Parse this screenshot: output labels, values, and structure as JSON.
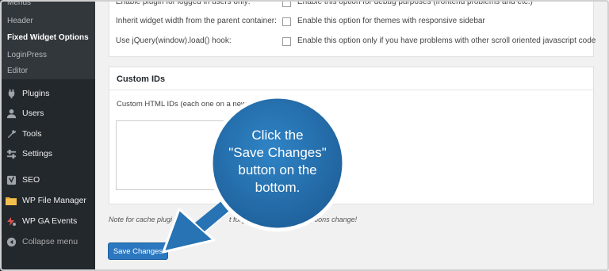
{
  "sidebar": {
    "submenu": {
      "items": [
        {
          "label": "Menus"
        },
        {
          "label": "Header"
        },
        {
          "label": "Fixed Widget Options"
        },
        {
          "label": "LoginPress"
        },
        {
          "label": "Editor"
        }
      ]
    },
    "menu": [
      {
        "label": "Plugins",
        "icon": "plug-icon"
      },
      {
        "label": "Users",
        "icon": "user-icon"
      },
      {
        "label": "Tools",
        "icon": "wrench-icon"
      },
      {
        "label": "Settings",
        "icon": "settings-icon"
      },
      {
        "label": "SEO",
        "icon": "yoast-icon"
      },
      {
        "label": "WP File Manager",
        "icon": "folder-icon"
      },
      {
        "label": "WP GA Events",
        "icon": "ga-events-icon"
      }
    ],
    "collapse_label": "Collapse menu",
    "colors": {
      "bg": "#23282d",
      "submenu_bg": "#32373c"
    }
  },
  "options": {
    "rows": [
      {
        "label": "Enable plugin for logged in users only:",
        "description": "Enable this option for debug purposes (frontend problems and etc.)"
      },
      {
        "label": "Inherit widget width from the parent container:",
        "description": "Enable this option for themes with responsive sidebar"
      },
      {
        "label": "Use jQuery(window).load() hook:",
        "description": "Enable this option only if you have problems with other scroll oriented javascript code"
      }
    ]
  },
  "custom_ids": {
    "title": "Custom IDs",
    "field_label": "Custom HTML IDs (each one on a new li",
    "value": ""
  },
  "note": {
    "left": "Note for cache plugi",
    "middle": "t forget t",
    "right": "after options change!"
  },
  "save_button": {
    "label": "Save Changes",
    "color": "#2b78c0"
  },
  "callout": {
    "line1": "Click the",
    "line2": "\"Save Changes\"",
    "line3": "button on the",
    "line4": "bottom.",
    "color": "#2773b3"
  }
}
